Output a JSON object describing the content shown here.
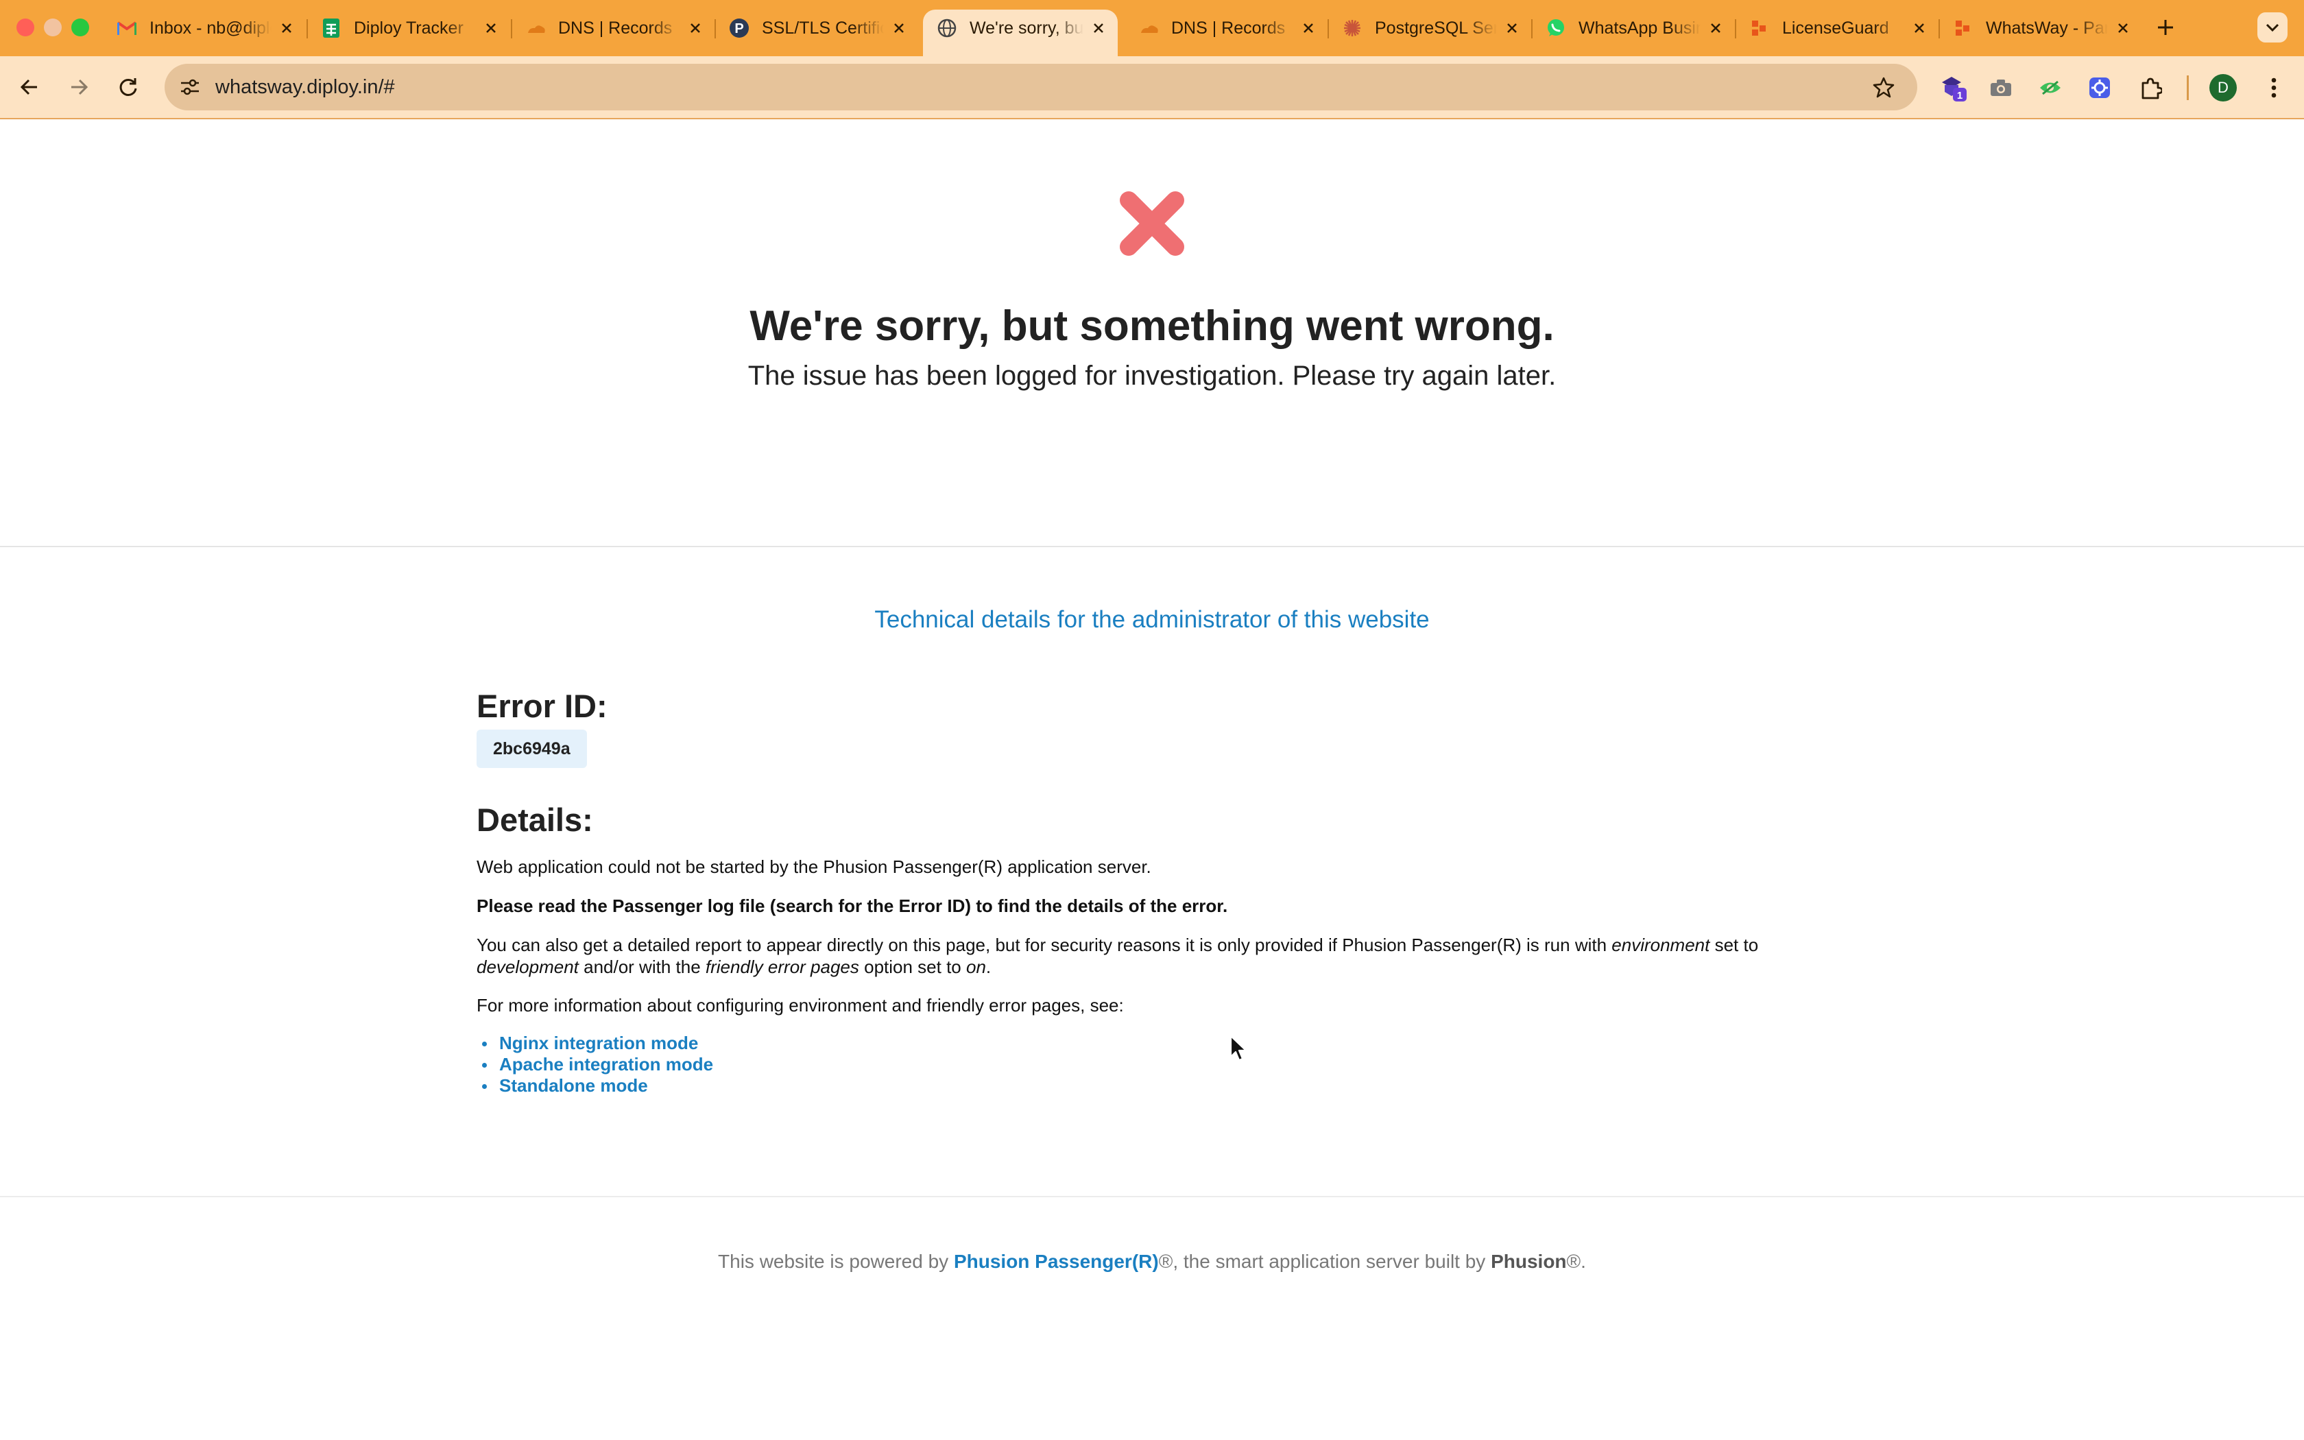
{
  "browser": {
    "tabs": [
      {
        "title": "Inbox - nb@diploy.in",
        "icon": "gmail-icon"
      },
      {
        "title": "Diploy Tracker",
        "icon": "sheets-icon"
      },
      {
        "title": "DNS | Records",
        "icon": "cloudflare-icon"
      },
      {
        "title": "SSL/TLS Certificates",
        "icon": "p-icon"
      },
      {
        "title": "We're sorry, but something went wrong",
        "icon": "globe-icon",
        "active": true
      },
      {
        "title": "DNS | Records",
        "icon": "cloudflare-icon"
      },
      {
        "title": "PostgreSQL Server",
        "icon": "asterisk-icon"
      },
      {
        "title": "WhatsApp Business",
        "icon": "whatsapp-icon"
      },
      {
        "title": "LicenseGuard",
        "icon": "diploy-icon"
      },
      {
        "title": "WhatsWay - Panel",
        "icon": "diploy-icon"
      }
    ],
    "url": "whatsway.diploy.in/#",
    "extension_badge": "1",
    "profile_initial": "D"
  },
  "page": {
    "headline": "We're sorry, but something went wrong.",
    "subline": "The issue has been logged for investigation. Please try again later.",
    "tech_link": "Technical details for the administrator of this website",
    "error_heading": "Error ID:",
    "error_id": "2bc6949a",
    "details_heading": "Details:",
    "p1": "Web application could not be started by the Phusion Passenger(R) application server.",
    "p2": "Please read the Passenger log file (search for the Error ID) to find the details of the error.",
    "p3_a": "You can also get a detailed report to appear directly on this page, but for security reasons it is only provided if Phusion Passenger(R) is run with ",
    "p3_env": "environment",
    "p3_b": " set to ",
    "p3_dev": "development",
    "p3_c": " and/or with the ",
    "p3_friendly": "friendly error pages",
    "p3_d": " option set to ",
    "p3_on": "on",
    "p3_e": ".",
    "p4": "For more information about configuring environment and friendly error pages, see:",
    "links": [
      "Nginx integration mode",
      "Apache integration mode",
      "Standalone mode"
    ],
    "footer_a": "This website is powered by ",
    "footer_link": "Phusion Passenger(R)",
    "footer_b": "®, the smart application server built by ",
    "footer_strong": "Phusion",
    "footer_c": "®."
  }
}
